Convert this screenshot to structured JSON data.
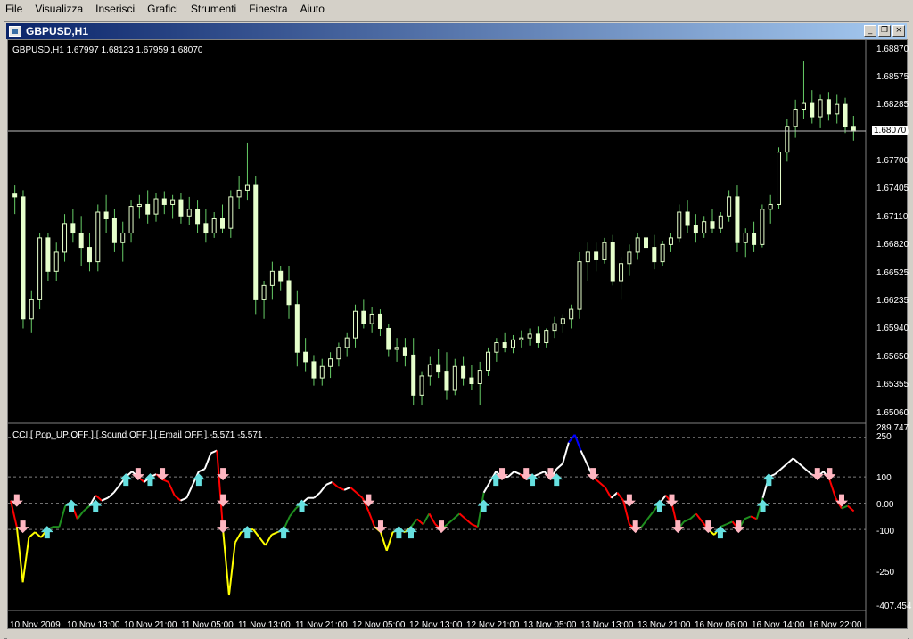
{
  "menu": [
    "File",
    "Visualizza",
    "Inserisci",
    "Grafici",
    "Strumenti",
    "Finestra",
    "Aiuto"
  ],
  "window": {
    "title": "GBPUSD,H1",
    "buttons": [
      "minimize",
      "restore",
      "close"
    ]
  },
  "main_chart": {
    "symbol_line": "GBPUSD,H1  1.67997 1.68123 1.67959 1.68070",
    "current_price": "1.68070",
    "price_ticks": [
      "1.68870",
      "1.68575",
      "1.68285",
      "1.67990",
      "1.67700",
      "1.67405",
      "1.67110",
      "1.66820",
      "1.66525",
      "1.66235",
      "1.65940",
      "1.65650",
      "1.65355",
      "1.65060"
    ]
  },
  "indicator": {
    "label": "CCI [ Pop_UP OFF ] [ Sound OFF ] [ Email OFF ] -5.571 -5.571",
    "ticks": [
      "289.747",
      "250",
      "100",
      "0.00",
      "-100",
      "-250",
      "-407.454"
    ]
  },
  "time_axis": [
    "10 Nov 2009",
    "10 Nov 13:00",
    "10 Nov 21:00",
    "11 Nov 05:00",
    "11 Nov 13:00",
    "11 Nov 21:00",
    "12 Nov 05:00",
    "12 Nov 13:00",
    "12 Nov 21:00",
    "13 Nov 05:00",
    "13 Nov 13:00",
    "13 Nov 21:00",
    "16 Nov 06:00",
    "16 Nov 14:00",
    "16 Nov 22:00"
  ],
  "colors": {
    "background": "#000000",
    "candle": "#e6ffcc",
    "wick": "#66cc66",
    "cci_red": "#ff0000",
    "cci_green": "#1f8f1f",
    "cci_blue": "#0000ff",
    "cci_yellow": "#ffff00",
    "cci_white": "#ffffff",
    "arrow_up": "#66e0e0",
    "arrow_down": "#ffb6c1"
  },
  "chart_data": [
    {
      "type": "candlestick",
      "title": "GBPUSD,H1",
      "ylim": [
        1.6506,
        1.6895
      ],
      "values": [
        [
          1.6741,
          1.675,
          1.672,
          1.6738
        ],
        [
          1.6738,
          1.6745,
          1.66,
          1.661
        ],
        [
          1.661,
          1.664,
          1.6595,
          1.663
        ],
        [
          1.663,
          1.67,
          1.662,
          1.6695
        ],
        [
          1.6695,
          1.67,
          1.665,
          1.666
        ],
        [
          1.666,
          1.669,
          1.665,
          1.668
        ],
        [
          1.668,
          1.672,
          1.667,
          1.671
        ],
        [
          1.671,
          1.6725,
          1.669,
          1.67
        ],
        [
          1.67,
          1.6718,
          1.6665,
          1.6685
        ],
        [
          1.6685,
          1.67,
          1.666,
          1.667
        ],
        [
          1.667,
          1.673,
          1.666,
          1.6722
        ],
        [
          1.6722,
          1.674,
          1.67,
          1.6715
        ],
        [
          1.6715,
          1.6725,
          1.668,
          1.669
        ],
        [
          1.669,
          1.6712,
          1.667,
          1.67
        ],
        [
          1.67,
          1.6735,
          1.669,
          1.6728
        ],
        [
          1.6728,
          1.674,
          1.6715,
          1.673
        ],
        [
          1.673,
          1.6745,
          1.671,
          1.672
        ],
        [
          1.672,
          1.6742,
          1.6712,
          1.6736
        ],
        [
          1.6736,
          1.6744,
          1.672,
          1.673
        ],
        [
          1.673,
          1.674,
          1.6715,
          1.6735
        ],
        [
          1.6735,
          1.6742,
          1.671,
          1.6718
        ],
        [
          1.6718,
          1.6738,
          1.6708,
          1.6725
        ],
        [
          1.6725,
          1.6735,
          1.67,
          1.671
        ],
        [
          1.671,
          1.6725,
          1.669,
          1.67
        ],
        [
          1.67,
          1.6722,
          1.6695,
          1.6715
        ],
        [
          1.6715,
          1.673,
          1.67,
          1.6705
        ],
        [
          1.6705,
          1.6745,
          1.6695,
          1.6738
        ],
        [
          1.6738,
          1.676,
          1.6725,
          1.6745
        ],
        [
          1.6745,
          1.6795,
          1.6735,
          1.675
        ],
        [
          1.675,
          1.676,
          1.6615,
          1.663
        ],
        [
          1.663,
          1.665,
          1.661,
          1.6645
        ],
        [
          1.6645,
          1.667,
          1.663,
          1.666
        ],
        [
          1.666,
          1.6665,
          1.664,
          1.665
        ],
        [
          1.665,
          1.6665,
          1.661,
          1.6625
        ],
        [
          1.6625,
          1.664,
          1.656,
          1.6575
        ],
        [
          1.6575,
          1.659,
          1.6555,
          1.6565
        ],
        [
          1.6565,
          1.6572,
          1.654,
          1.6548
        ],
        [
          1.6548,
          1.6568,
          1.654,
          1.656
        ],
        [
          1.656,
          1.6575,
          1.6548,
          1.6568
        ],
        [
          1.6568,
          1.6585,
          1.656,
          1.658
        ],
        [
          1.658,
          1.6595,
          1.657,
          1.659
        ],
        [
          1.659,
          1.6625,
          1.658,
          1.6618
        ],
        [
          1.6618,
          1.663,
          1.66,
          1.6605
        ],
        [
          1.6605,
          1.6622,
          1.6595,
          1.6615
        ],
        [
          1.6615,
          1.662,
          1.6592,
          1.66
        ],
        [
          1.66,
          1.6605,
          1.657,
          1.6578
        ],
        [
          1.6578,
          1.659,
          1.6565,
          1.658
        ],
        [
          1.658,
          1.659,
          1.656,
          1.6572
        ],
        [
          1.6572,
          1.659,
          1.652,
          1.653
        ],
        [
          1.653,
          1.6555,
          1.652,
          1.655
        ],
        [
          1.655,
          1.657,
          1.654,
          1.6562
        ],
        [
          1.6562,
          1.6578,
          1.6548,
          1.6555
        ],
        [
          1.6555,
          1.6575,
          1.6525,
          1.6535
        ],
        [
          1.6535,
          1.6568,
          1.653,
          1.656
        ],
        [
          1.656,
          1.657,
          1.654,
          1.6548
        ],
        [
          1.6548,
          1.6562,
          1.6535,
          1.6542
        ],
        [
          1.6542,
          1.6565,
          1.652,
          1.6556
        ],
        [
          1.6556,
          1.658,
          1.655,
          1.6575
        ],
        [
          1.6575,
          1.659,
          1.6565,
          1.6585
        ],
        [
          1.6585,
          1.6595,
          1.6575,
          1.658
        ],
        [
          1.658,
          1.6593,
          1.6574,
          1.6588
        ],
        [
          1.6588,
          1.6598,
          1.658,
          1.659
        ],
        [
          1.659,
          1.66,
          1.6582,
          1.6594
        ],
        [
          1.6594,
          1.6602,
          1.658,
          1.6585
        ],
        [
          1.6585,
          1.66,
          1.658,
          1.6598
        ],
        [
          1.6598,
          1.6612,
          1.659,
          1.6605
        ],
        [
          1.6605,
          1.6615,
          1.6595,
          1.661
        ],
        [
          1.661,
          1.6625,
          1.66,
          1.662
        ],
        [
          1.662,
          1.668,
          1.661,
          1.667
        ],
        [
          1.667,
          1.669,
          1.665,
          1.668
        ],
        [
          1.668,
          1.669,
          1.666,
          1.6672
        ],
        [
          1.6672,
          1.6695,
          1.6668,
          1.669
        ],
        [
          1.669,
          1.6698,
          1.6645,
          1.665
        ],
        [
          1.665,
          1.6675,
          1.663,
          1.6668
        ],
        [
          1.6668,
          1.6688,
          1.6655,
          1.668
        ],
        [
          1.668,
          1.67,
          1.6672,
          1.6695
        ],
        [
          1.6695,
          1.6705,
          1.6675,
          1.6685
        ],
        [
          1.6685,
          1.6698,
          1.6662,
          1.667
        ],
        [
          1.667,
          1.6692,
          1.6665,
          1.6688
        ],
        [
          1.6688,
          1.67,
          1.668,
          1.6695
        ],
        [
          1.6695,
          1.673,
          1.669,
          1.6722
        ],
        [
          1.6722,
          1.6735,
          1.67,
          1.6708
        ],
        [
          1.6708,
          1.672,
          1.669,
          1.67
        ],
        [
          1.67,
          1.6718,
          1.6695,
          1.6712
        ],
        [
          1.6712,
          1.6725,
          1.67,
          1.6705
        ],
        [
          1.6705,
          1.6722,
          1.67,
          1.6718
        ],
        [
          1.6718,
          1.6745,
          1.6712,
          1.6738
        ],
        [
          1.6738,
          1.675,
          1.668,
          1.669
        ],
        [
          1.669,
          1.6705,
          1.6675,
          1.67
        ],
        [
          1.67,
          1.6712,
          1.668,
          1.6688
        ],
        [
          1.6688,
          1.673,
          1.6685,
          1.6725
        ],
        [
          1.6725,
          1.674,
          1.671,
          1.673
        ],
        [
          1.673,
          1.679,
          1.6725,
          1.6785
        ],
        [
          1.6785,
          1.682,
          1.6775,
          1.6812
        ],
        [
          1.6812,
          1.684,
          1.68,
          1.683
        ],
        [
          1.683,
          1.688,
          1.682,
          1.6836
        ],
        [
          1.6836,
          1.685,
          1.6815,
          1.6822
        ],
        [
          1.6822,
          1.6845,
          1.681,
          1.684
        ],
        [
          1.684,
          1.6848,
          1.6818,
          1.6825
        ],
        [
          1.6825,
          1.6845,
          1.6815,
          1.6835
        ],
        [
          1.6835,
          1.6842,
          1.6805,
          1.6812
        ],
        [
          1.6812,
          1.6823,
          1.6797,
          1.6807
        ]
      ]
    },
    {
      "type": "line",
      "title": "CCI",
      "ylim": [
        -407.454,
        289.747
      ],
      "values": [
        10,
        -90,
        -300,
        -130,
        -110,
        -130,
        -100,
        -90,
        -90,
        -10,
        0,
        -60,
        -30,
        -10,
        30,
        10,
        20,
        40,
        70,
        100,
        120,
        100,
        80,
        100,
        110,
        90,
        80,
        30,
        10,
        20,
        70,
        120,
        130,
        190,
        200,
        -100,
        -350,
        -150,
        -110,
        -100,
        -100,
        -130,
        -160,
        -120,
        -110,
        -100,
        -50,
        -20,
        0,
        20,
        20,
        40,
        70,
        80,
        60,
        50,
        60,
        40,
        20,
        -30,
        -90,
        -110,
        -180,
        -110,
        -100,
        -110,
        -90,
        -60,
        -80,
        -40,
        -80,
        -100,
        -80,
        -60,
        -40,
        -60,
        -80,
        -90,
        40,
        80,
        120,
        100,
        100,
        120,
        110,
        90,
        100,
        110,
        120,
        90,
        130,
        150,
        230,
        260,
        200,
        150,
        100,
        80,
        60,
        20,
        40,
        10,
        -80,
        -100,
        -90,
        -60,
        -30,
        0,
        30,
        0,
        -100,
        -70,
        -60,
        -40,
        -70,
        -100,
        -120,
        -90,
        -80,
        -70,
        -100,
        -60,
        -50,
        -60,
        20,
        100,
        110,
        130,
        150,
        170,
        150,
        130,
        110,
        100,
        120,
        90,
        20,
        -20,
        -10,
        -30
      ]
    }
  ]
}
